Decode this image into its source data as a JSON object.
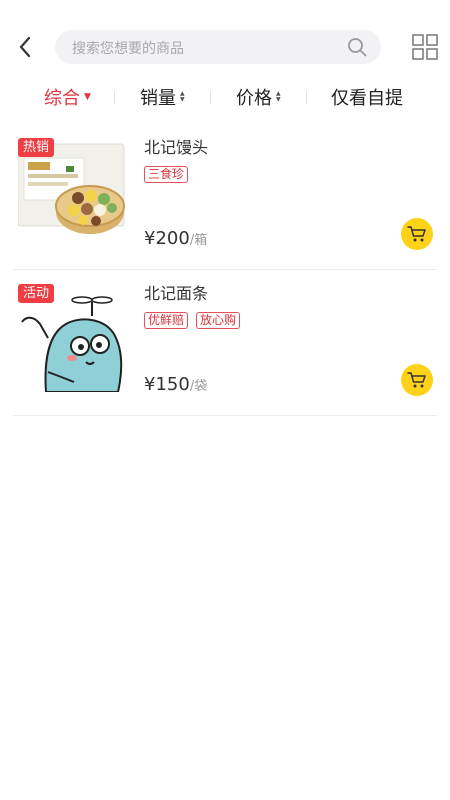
{
  "search": {
    "placeholder": "搜索您想要的商品"
  },
  "tabs": [
    {
      "label": "综合"
    },
    {
      "label": "销量"
    },
    {
      "label": "价格"
    },
    {
      "label": "仅看自提"
    }
  ],
  "products": [
    {
      "badge": "热销",
      "name": "北记馒头",
      "tags": [
        "三食珍"
      ],
      "price": "¥200",
      "unit": "/箱"
    },
    {
      "badge": "活动",
      "name": "北记面条",
      "tags": [
        "优鲜赔",
        "放心购"
      ],
      "price": "¥150",
      "unit": "/袋"
    }
  ],
  "colors": {
    "accent": "#e0343f",
    "badge": "#ef3d44",
    "cart": "#ffd21a"
  }
}
